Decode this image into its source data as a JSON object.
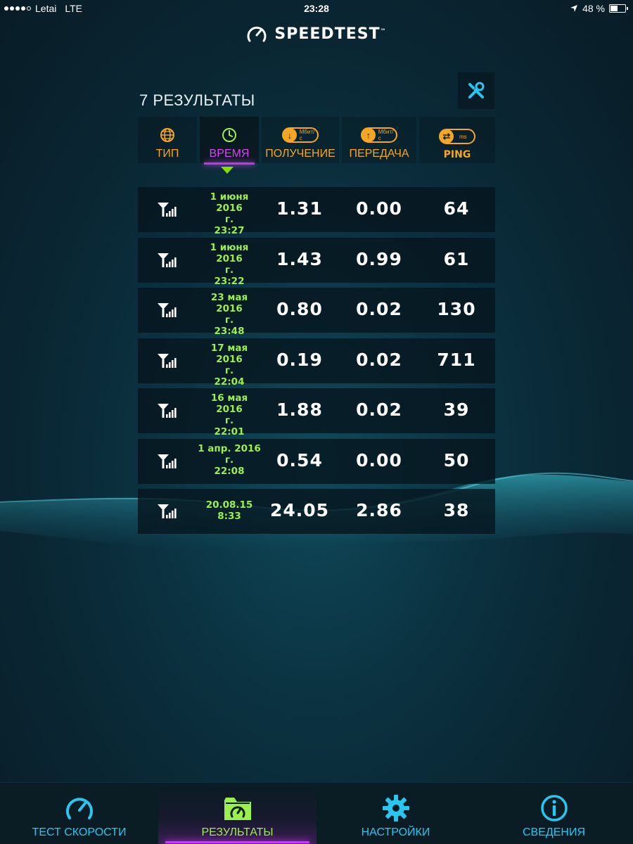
{
  "status_bar": {
    "carrier": "Letai",
    "network": "LTE",
    "time": "23:28",
    "battery": "48 %"
  },
  "app": {
    "logo_text": "SPEEDTEST",
    "logo_tm": "™"
  },
  "results": {
    "title": "7 РЕЗУЛЬТАТЫ",
    "columns": {
      "type": "ТИП",
      "time": "ВРЕМЯ",
      "download": "ПОЛУЧЕНИЕ",
      "upload": "ПЕРЕДАЧА",
      "ping": "PING",
      "download_unit": "Мбит/с",
      "upload_unit": "Мбит/с",
      "ping_unit": "ms"
    },
    "rows": [
      {
        "date": "1 июня 2016",
        "g": "г.",
        "time": "23:27",
        "download": "1.31",
        "upload": "0.00",
        "ping": "64"
      },
      {
        "date": "1 июня 2016",
        "g": "г.",
        "time": "23:22",
        "download": "1.43",
        "upload": "0.99",
        "ping": "61"
      },
      {
        "date": "23 мая 2016",
        "g": "г.",
        "time": "23:48",
        "download": "0.80",
        "upload": "0.02",
        "ping": "130"
      },
      {
        "date": "17 мая 2016",
        "g": "г.",
        "time": "22:04",
        "download": "0.19",
        "upload": "0.02",
        "ping": "711"
      },
      {
        "date": "16 мая 2016",
        "g": "г.",
        "time": "22:01",
        "download": "1.88",
        "upload": "0.02",
        "ping": "39"
      },
      {
        "date": "1 апр. 2016",
        "g": "г.",
        "time": "22:08",
        "download": "0.54",
        "upload": "0.00",
        "ping": "50"
      },
      {
        "date": "20.08.15",
        "time": "8:33",
        "download": "24.05",
        "upload": "2.86",
        "ping": "38"
      }
    ]
  },
  "tabs": [
    {
      "label": "ТЕСТ СКОРОСТИ",
      "icon": "speedometer-icon"
    },
    {
      "label": "РЕЗУЛЬТАТЫ",
      "icon": "results-folder-icon"
    },
    {
      "label": "НАСТРОЙКИ",
      "icon": "gear-icon"
    },
    {
      "label": "СВЕДЕНИЯ",
      "icon": "info-icon"
    }
  ],
  "colors": {
    "accent_orange": "#f5a623",
    "accent_green": "#9cf04b",
    "accent_cyan": "#29c6f2",
    "accent_purple": "#e040fb"
  }
}
